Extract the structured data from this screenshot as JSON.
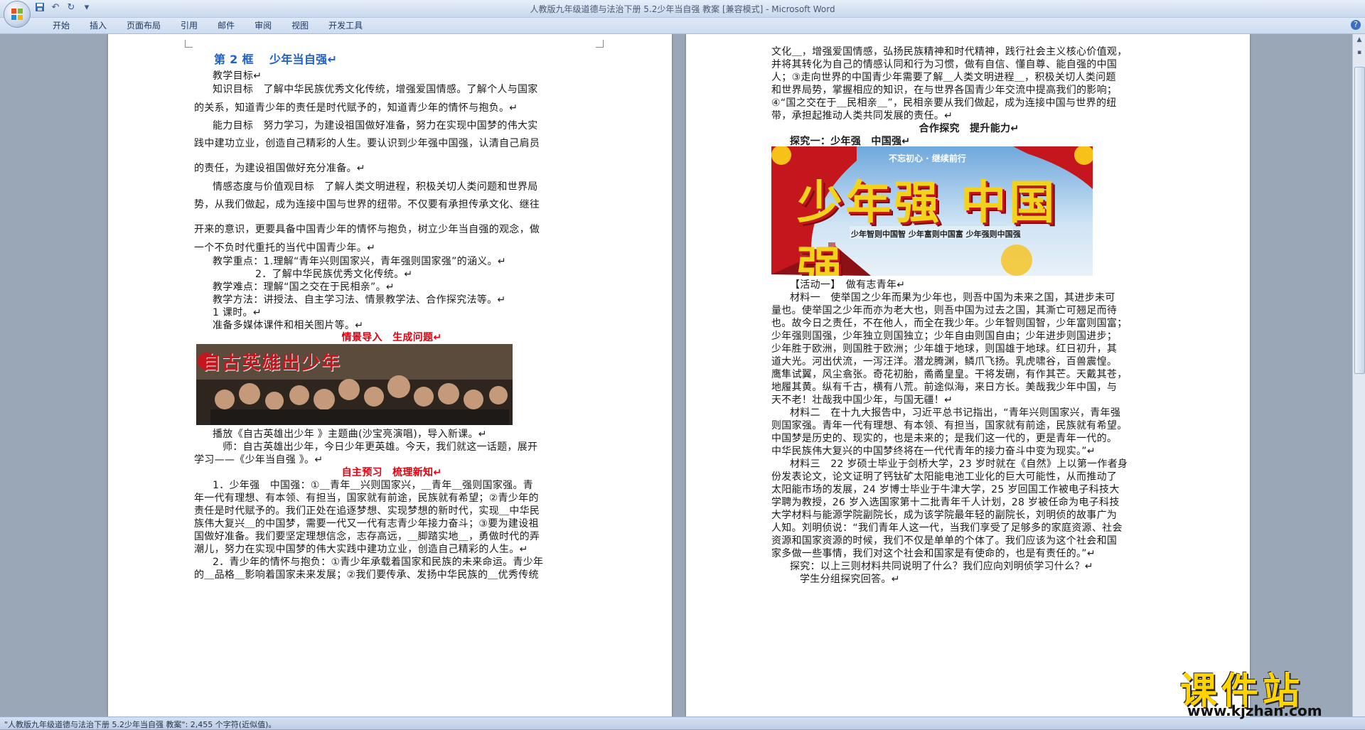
{
  "window": {
    "title": "人教版九年级道德与法治下册 5.2少年当自强 教案 [兼容模式] - Microsoft Word"
  },
  "ribbon": {
    "tabs": [
      "开始",
      "插入",
      "页面布局",
      "引用",
      "邮件",
      "审阅",
      "视图",
      "开发工具"
    ],
    "help": "?"
  },
  "page1": {
    "heading": "第 2 框　 少年当自强↵",
    "lines": [
      "教学目标↵",
      "知识目标　了解中华民族优秀文化传统，增强爱国情感。了解个人与国家",
      "的关系，知道青少年的责任是时代赋予的，知道青少年的情怀与抱负。↵",
      "能力目标　努力学习，为建设祖国做好准备，努力在实现中国梦的伟大实",
      "践中建功立业，创造自己精彩的人生。要认识到少年强中国强，认清自己肩员",
      "的责任，为建设祖国做好充分准备。↵",
      "情感态度与价值观目标　了解人类文明进程，积极关切人类问题和世界局",
      "势，从我们做起，成为连接中国与世界的纽带。不仅要有承担传承文化、继往",
      "开来的意识，更要具备中国青少年的情怀与抱负，树立少年当自强的观念，做",
      "一个不负时代重托的当代中国青少年。↵",
      "教学重点：1.理解“青年兴则国家兴，青年强则国家强”的涵义。↵",
      "2．了解中华民族优秀文化传统。↵",
      "教学难点：理解“国之交在于民相亲”。↵",
      "教学方法：讲授法、自主学习法、情景教学法、合作探究法等。↵",
      "1 课时。↵",
      "准备多媒体课件和相关图片等。↵"
    ],
    "section1": "情景导入　生成问题↵",
    "image1_text": "自古英雄出少年",
    "after_image": [
      "播放《自古英雄出少年 》主题曲(沙宝亮演唱)，导入新课。↵",
      "师：自古英雄出少年，今日少年更英雄。今天，我们就这一话题，展开",
      "学习——《少年当自强 》。↵"
    ],
    "section2": "自主预习　梳理新知↵",
    "preview": [
      "1．少年强　中国强：①＿青年＿兴则国家兴，＿青年＿强则国家强。青",
      "年一代有理想、有本领、有担当，国家就有前途，民族就有希望；②青少年的",
      "责任是时代赋予的。我们正处在追逐梦想、实现梦想的新时代，实现＿中华民",
      "族伟大复兴＿的中国梦，需要一代又一代有志青少年接力奋斗；③要为建设祖",
      "国做好准备。我们要坚定理想信念，志存高远，＿脚踏实地＿，勇做时代的弄",
      "潮儿，努力在实现中国梦的伟大实践中建功立业，创造自己精彩的人生。↵",
      "2．青少年的情怀与抱负：①青少年承载着国家和民族的未来命运。青少年",
      "的＿品格＿影响着国家未来发展；②我们要传承、发扬中华民族的＿优秀传统"
    ]
  },
  "page2": {
    "top_lines": [
      "文化＿，增强爱国情感，弘扬民族精神和时代精神，践行社会主义核心价值观，",
      "并将其转化为自己的情感认同和行为习惯，做有自信、懂自尊、能自强的中国",
      "人；③走向世界的中国青少年需要了解＿人类文明进程＿，积极关切人类问题",
      "和世界局势，掌握相应的知识，在与世界各国青少年交流中提高我们的影响；",
      "④“国之交在于＿民相亲＿”，民相亲要从我们做起，成为连接中国与世界的纽",
      "带，承担起推动人类共同发展的责任。↵"
    ],
    "section": "合作探究　提升能力↵",
    "explore1": "探究一：少年强　中国强↵",
    "poster": {
      "slogan": "不忘初心 · 继续前行",
      "big": "少年强 中国强",
      "sub": "少年智则中国智 少年富则中国富 少年强则中国强"
    },
    "activity": "【活动一】　做有志青年↵",
    "material1": [
      "材料一　使举国之少年而果为少年也，则吾中国为未来之国，其进步未可",
      "量也。使举国之少年而亦为老大也，则吾中国为过去之国，其澌亡可翘足而待",
      "也。故今日之责任，不在他人，而全在我少年。少年智则国智，少年富则国富；",
      "少年强则国强，少年独立则国独立；少年自由则国自由；少年进步则国进步；",
      "少年胜于欧洲，则国胜于欧洲；少年雄于地球，则国雄于地球。红日初升，其",
      "道大光。河出伏流，一泻汪洋。潜龙腾渊，鳞爪飞扬。乳虎啸谷，百兽震惶。",
      "鹰隼试翼，风尘翕张。奇花初胎，矞矞皇皇。干将发硎，有作其芒。天戴其苍，",
      "地履其黄。纵有千古，横有八荒。前途似海，来日方长。美哉我少年中国，与",
      "天不老！壮哉我中国少年，与国无疆！↵"
    ],
    "material2": [
      "材料二　在十九大报告中，习近平总书记指出，“青年兴则国家兴，青年强",
      "则国家强。青年一代有理想、有本领、有担当，国家就有前途，民族就有希望。",
      "中国梦是历史的、现实的，也是未来的；是我们这一代的，更是青年一代的。",
      "中华民族伟大复兴的中国梦终将在一代代青年的接力奋斗中变为现实。”↵"
    ],
    "material3": [
      "材料三　22 岁硕士毕业于剑桥大学，23 岁时就在《自然》上以第一作者身",
      "份发表论文，论文证明了钙钛矿太阳能电池工业化的巨大可能性，从而推动了",
      "太阳能市场的发展，24 岁博士毕业于牛津大学，25 岁回国工作被电子科技大",
      "学聘为教授，26 岁入选国家第十二批青年千人计划，28 岁被任命为电子科技",
      "大学材料与能源学院副院长，成为该学院最年轻的副院长，刘明侦的故事广为",
      "人知。刘明侦说：“我们青年人这一代，当我们享受了足够多的家庭资源、社会",
      "资源和国家资源的时候，我们不仅是单单的个体了。我们应该为这个社会和国",
      "家多做一些事情，我们对这个社会和国家是有使命的，也是有责任的。”↵"
    ],
    "question": "探究：以上三则材料共同说明了什么？我们应向刘明侦学习什么？↵",
    "group": "学生分组探究回答。↵"
  },
  "status": {
    "text": "\"人教版九年级道德与法治下册 5.2少年当自强 教案\": 2,455 个字符(近似值)。"
  },
  "watermark": {
    "brand": "课件站",
    "url": "www.kjzhan.com"
  }
}
